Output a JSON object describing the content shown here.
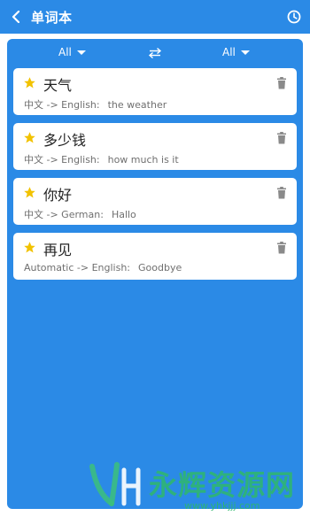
{
  "header": {
    "title": "单词本",
    "back_icon": "chevron-left-icon",
    "history_icon": "clock-icon"
  },
  "lang_bar": {
    "from": "All",
    "to": "All",
    "swap_icon": "swap-arrows-icon"
  },
  "items": [
    {
      "word": "天气",
      "direction": "中文 -> English:",
      "translation": "the weather",
      "starred": true
    },
    {
      "word": "多少钱",
      "direction": "中文 -> English:",
      "translation": "how much is it",
      "starred": true
    },
    {
      "word": "你好",
      "direction": "中文 -> German:",
      "translation": "Hallo",
      "starred": true
    },
    {
      "word": "再见",
      "direction": "Automatic -> English:",
      "translation": "Goodbye",
      "starred": true
    }
  ],
  "watermark": {
    "text": "永辉资源网",
    "url": "www.yhkjjj.com"
  },
  "colors": {
    "primary": "#2b8ae6",
    "star": "#f2c200",
    "watermark": "#2fb86b"
  }
}
